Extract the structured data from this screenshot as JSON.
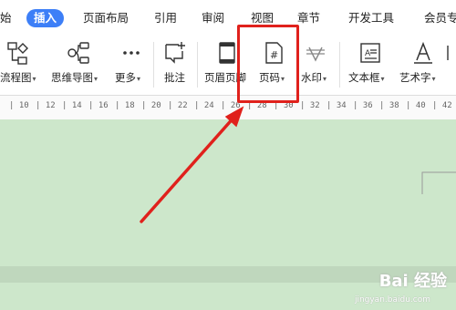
{
  "tabs": [
    "始",
    "插入",
    "页面布局",
    "引用",
    "审阅",
    "视图",
    "章节",
    "开发工具",
    "会员专"
  ],
  "ribbon": {
    "flowchart": "流程图",
    "mindmap": "思维导图",
    "more": "更多",
    "comment": "批注",
    "header_footer": "页眉页脚",
    "page_number": "页码",
    "watermark": "水印",
    "textbox": "文本框",
    "wordart": "艺术字"
  },
  "ruler": [
    "10",
    "12",
    "14",
    "16",
    "18",
    "20",
    "22",
    "24",
    "26",
    "28",
    "30",
    "32",
    "34",
    "36",
    "38",
    "40",
    "42"
  ],
  "watermark": {
    "logo": "Bai 经验",
    "url": "jingyan.baidu.com"
  },
  "colors": {
    "accent": "#3d7ff7",
    "highlight": "#e0211c",
    "doc_bg": "#cde7cb"
  },
  "icons": [
    "flowchart-icon",
    "mindmap-icon",
    "more-dots-icon",
    "comment-icon",
    "header-footer-icon",
    "page-number-icon",
    "watermark-icon",
    "textbox-icon",
    "wordart-icon"
  ]
}
